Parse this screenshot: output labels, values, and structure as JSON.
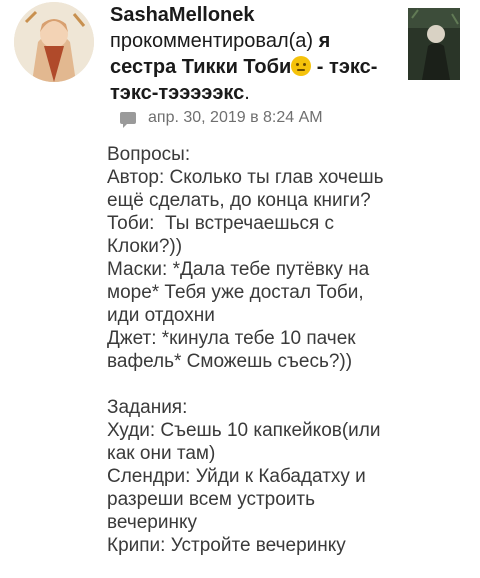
{
  "comment": {
    "author": "SashaMellonek",
    "action": "прокомментировал(а)",
    "post_title_part1": "я сестра Тикки Тоби",
    "emoji": "face-with-no-mouth-emoji",
    "post_title_part2": " - тэкс-тэкс-тэээээкс",
    "period": ".",
    "timestamp": "апр. 30, 2019 в 8:24 AM",
    "body_lines": [
      "Вопросы:",
      "Автор: Сколько ты глав хочешь",
      "ещё сделать, до конца книги?",
      "Тоби:  Ты встречаешься с",
      "Клоки?))",
      "Маски: *Дала тебе путёвку на",
      "море* Тебя уже достал Тоби,",
      "иди отдохни",
      "Джет: *кинула тебе 10 пачек",
      "вафель* Сможешь съесь?))",
      "",
      "Задания:",
      "Худи: Съешь 10 капкейков(или",
      "как они там)",
      "Слендри: Уйди к Кабадатху и",
      "разреши всем устроить",
      "вечеринку",
      "Крипи: Устройте вечеринку"
    ]
  },
  "colors": {
    "text": "#1a1a1a",
    "body_text": "#3a3a3a",
    "meta": "#6f6f6f",
    "emoji": "#f5c20b"
  }
}
